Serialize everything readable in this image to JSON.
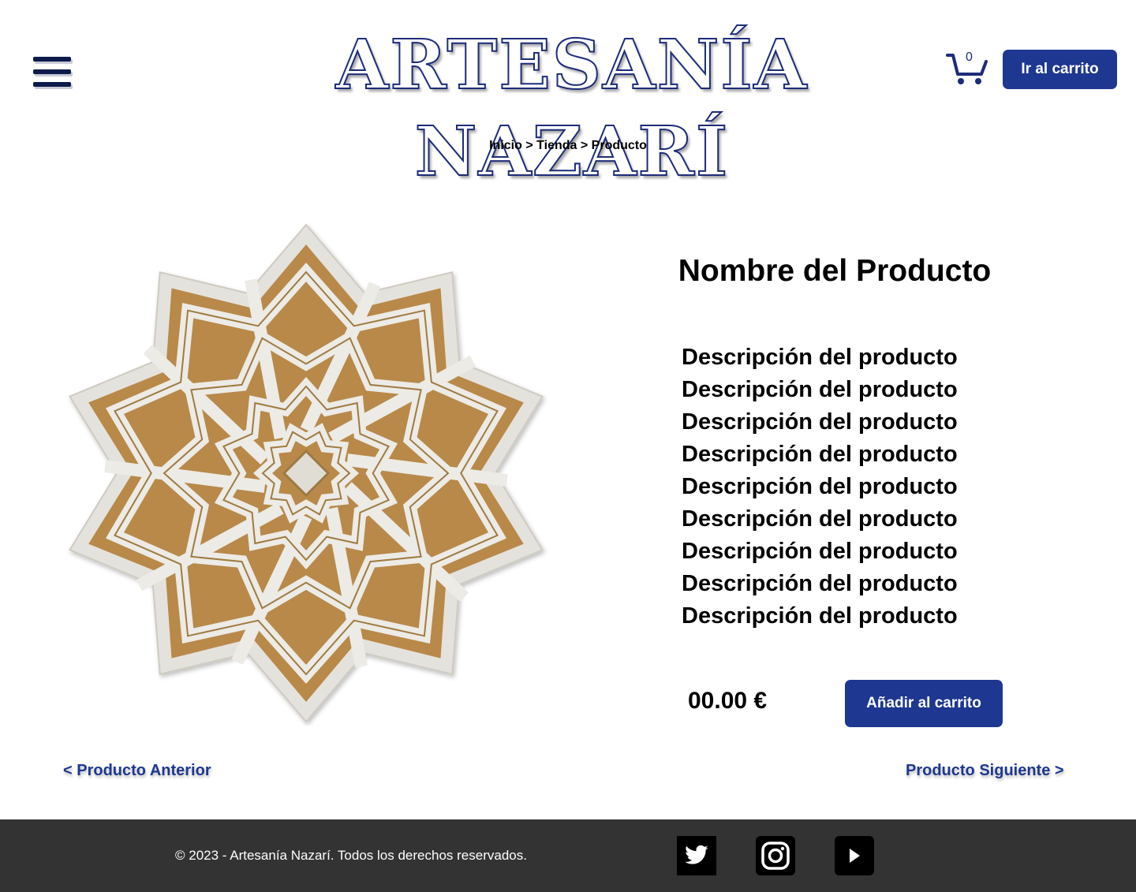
{
  "header": {
    "logo_text": "Artesanía Nazarí",
    "cart_count": "0",
    "go_cart_label": "Ir al carrito"
  },
  "breadcrumb": {
    "items": [
      "Inicio",
      "Tienda",
      "Producto"
    ],
    "separator": ">"
  },
  "product": {
    "name": "Nombre del Producto",
    "description_lines": [
      "Descripción del producto",
      "Descripción del producto",
      "Descripción del producto",
      "Descripción del producto",
      "Descripción del producto",
      "Descripción del producto",
      "Descripción del producto",
      "Descripción del producto",
      "Descripción del producto"
    ],
    "price": "00.00 €",
    "add_to_cart_label": "Añadir al carrito"
  },
  "navigation": {
    "prev_label": "<  Producto Anterior",
    "next_label": "Producto Siguiente  >"
  },
  "footer": {
    "copyright": "© 2023 - Artesanía Nazarí. Todos los derechos reservados.",
    "social": [
      "twitter-icon",
      "instagram-icon",
      "youtube-icon"
    ]
  },
  "colors": {
    "accent": "#1e3790",
    "footer_bg": "#333333",
    "logo_stroke": "#1d2c7a"
  }
}
